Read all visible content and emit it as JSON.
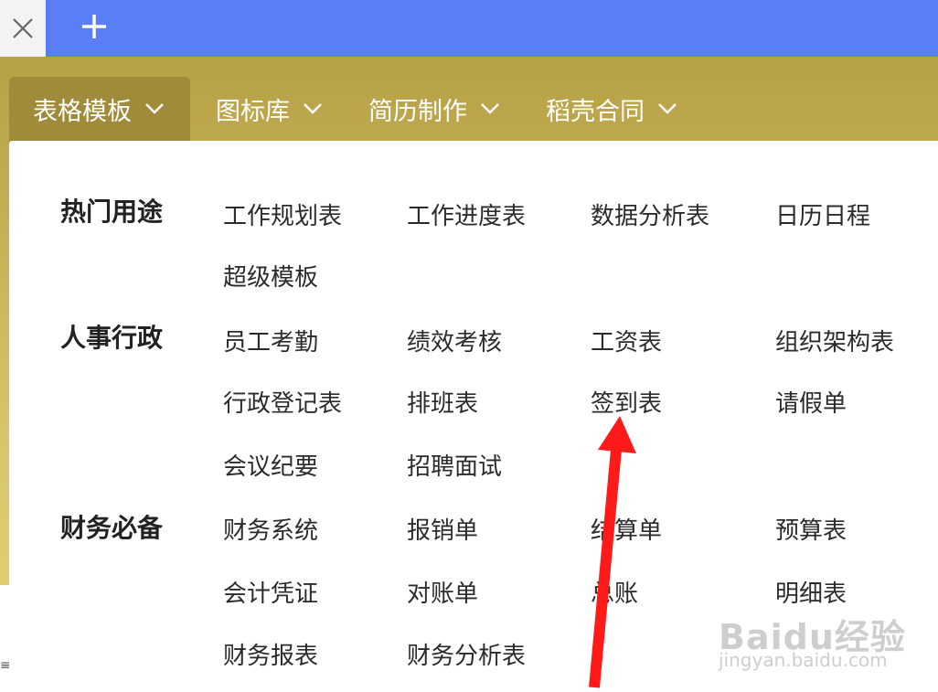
{
  "browser": {
    "close_tab_icon": "close-icon",
    "new_tab_icon": "plus-icon"
  },
  "nav": {
    "items": [
      {
        "label": "表格模板",
        "active": true
      },
      {
        "label": "图标库",
        "active": false
      },
      {
        "label": "简历制作",
        "active": false
      },
      {
        "label": "稻壳合同",
        "active": false
      }
    ]
  },
  "menu": {
    "groups": [
      {
        "title": "热门用途",
        "items": [
          "工作规划表",
          "工作进度表",
          "数据分析表",
          "日历日程",
          "超级模板"
        ]
      },
      {
        "title": "人事行政",
        "items": [
          "员工考勤",
          "绩效考核",
          "工资表",
          "组织架构表",
          "行政登记表",
          "排班表",
          "签到表",
          "请假单",
          "会议纪要",
          "招聘面试"
        ]
      },
      {
        "title": "财务必备",
        "items": [
          "财务系统",
          "报销单",
          "结算单",
          "预算表",
          "会计凭证",
          "对账单",
          "总账",
          "明细表",
          "财务报表",
          "财务分析表"
        ]
      }
    ]
  },
  "annotation": {
    "arrow_color": "#ff1a1a",
    "points_to": "签到表"
  },
  "watermark": {
    "logo": "Baidu经验",
    "sub": "jingyan.baidu.com"
  },
  "colors": {
    "tabstrip": "#5a7ff5",
    "app_gold": "#c4af54",
    "nav_active": "#9f8b3a"
  }
}
